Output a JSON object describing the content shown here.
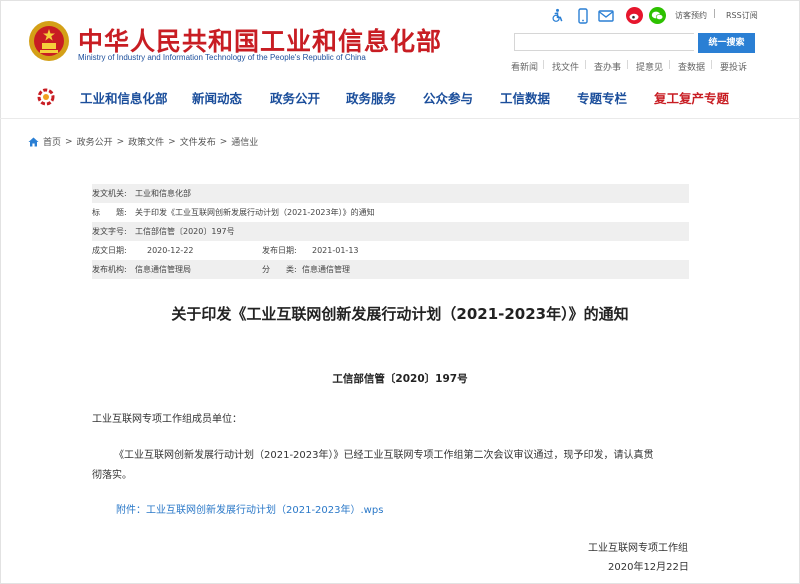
{
  "header": {
    "title": "中华人民共和国工业和信息化部",
    "subtitle": "Ministry of Industry and Information Technology of the People's Republic of China",
    "util": {
      "visit": "访客预约",
      "sep": "|",
      "rss": "RSS订阅"
    },
    "search": {
      "placeholder": "",
      "button": "统一搜索"
    },
    "quick_links": [
      "看新闻",
      "找文件",
      "查办事",
      "提意见",
      "查数据",
      "要投诉"
    ]
  },
  "nav": {
    "items": [
      "工业和信息化部",
      "新闻动态",
      "政务公开",
      "政务服务",
      "公众参与",
      "工信数据",
      "专题专栏",
      "复工复产专题"
    ],
    "highlight_color": "#c81d23",
    "color": "#1b4e9b"
  },
  "breadcrumb": [
    "首页",
    ">",
    "政务公开",
    ">",
    "政策文件",
    ">",
    "文件发布",
    ">",
    "通信业"
  ],
  "meta": {
    "issuer_label": "发文机关:",
    "issuer": "工业和信息化部",
    "title_label": "标　　题:",
    "title": "关于印发《工业互联网创新发展行动计划（2021-2023年）》的通知",
    "doc_no_label": "发文字号:",
    "doc_no": "工信部信管〔2020〕197号",
    "created_label": "成文日期:",
    "created": "2020-12-22",
    "published_label": "发布日期:",
    "published": "2021-01-13",
    "org_label": "发布机构:",
    "org": "信息通信管理局",
    "category_label": "分　　类:",
    "category": "信息通信管理"
  },
  "document": {
    "title": "关于印发《工业互联网创新发展行动计划（2021-2023年）》的通知",
    "number": "工信部信管〔2020〕197号",
    "salutation": "工业互联网专项工作组成员单位：",
    "body_line1": "《工业互联网创新发展行动计划（2021-2023年）》已经工业互联网专项工作组第二次会议审议通过，现予印发，请认真贯",
    "body_line2": "彻落实。",
    "attachment": "附件：工业互联网创新发展行动计划（2021-2023年）.wps",
    "signature": "工业互联网专项工作组",
    "date": "2020年12月22日"
  }
}
